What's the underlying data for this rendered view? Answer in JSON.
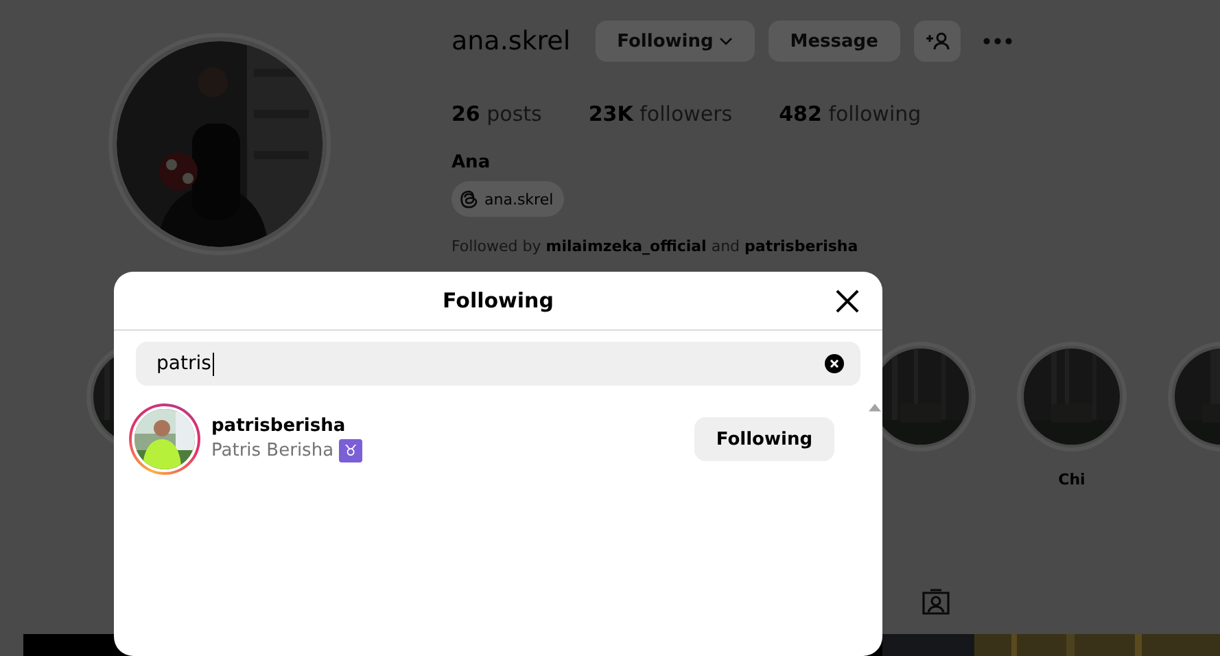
{
  "profile": {
    "username": "ana.skrel",
    "follow_button": "Following",
    "message_button": "Message",
    "stats": [
      {
        "count": "26",
        "label": "posts"
      },
      {
        "count": "23K",
        "label": "followers"
      },
      {
        "count": "482",
        "label": "following"
      }
    ],
    "name": "Ana",
    "threads_handle": "ana.skrel",
    "followed_by": "Followed by **milaimzeka_official** and **patrisberisha**"
  },
  "highlights": [
    {
      "kind": "cover"
    },
    {
      "kind": "cover"
    },
    {
      "kind": "cover",
      "label": "Chi"
    },
    {
      "kind": "cover"
    }
  ],
  "modal": {
    "title": "Following",
    "search": {
      "value": "patris"
    },
    "results": [
      {
        "username": "patrisberisha",
        "full_name": "Patris Berisha",
        "badge": "♉",
        "button": "Following",
        "has_story": true
      }
    ]
  }
}
